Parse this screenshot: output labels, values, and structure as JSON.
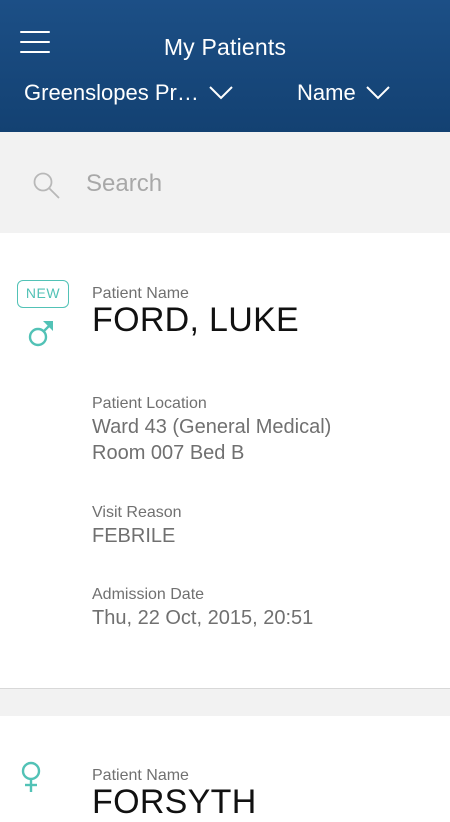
{
  "header": {
    "title": "My Patients",
    "hospital_filter": "Greenslopes Pr…",
    "sort_filter": "Name",
    "menu_icon": "hamburger-menu-icon",
    "chevron_icon": "chevron-down-icon",
    "background_color": "#1a4a7e"
  },
  "search": {
    "placeholder": "Search",
    "icon": "search-icon"
  },
  "accent_color": "#52c2b6",
  "patients": [
    {
      "badge": "NEW",
      "gender_icon": "male-icon",
      "name_label": "Patient Name",
      "name": "FORD, LUKE",
      "location_label": "Patient Location",
      "location_ward": "Ward 43 (General Medical)",
      "location_room": "Room 007 Bed B",
      "visit_reason_label": "Visit Reason",
      "visit_reason": "FEBRILE",
      "admission_date_label": "Admission Date",
      "admission_date": "Thu, 22 Oct, 2015, 20:51"
    },
    {
      "gender_icon": "female-icon",
      "name_label": "Patient Name",
      "name": "FORSYTH"
    }
  ]
}
